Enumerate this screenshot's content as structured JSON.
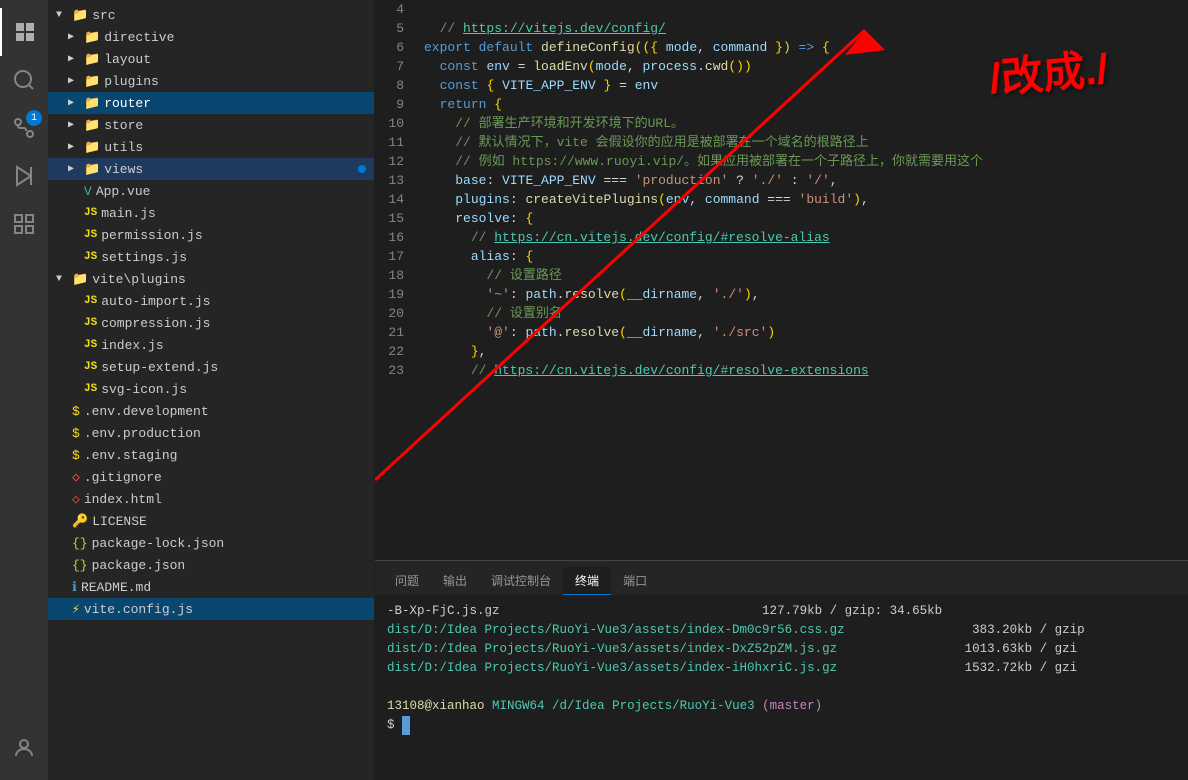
{
  "sidebar": {
    "icons": [
      {
        "name": "explorer-icon",
        "symbol": "⎘",
        "active": true,
        "badge": null
      },
      {
        "name": "search-icon",
        "symbol": "🔍",
        "active": false,
        "badge": null
      },
      {
        "name": "git-icon",
        "symbol": "⎇",
        "active": false,
        "badge": "1"
      },
      {
        "name": "debug-icon",
        "symbol": "▶",
        "active": false,
        "badge": null
      },
      {
        "name": "extensions-icon",
        "symbol": "⊞",
        "active": false,
        "badge": null
      },
      {
        "name": "accounts-icon",
        "symbol": "◉",
        "active": false,
        "badge": null
      }
    ],
    "tree": [
      {
        "label": "src",
        "indent": 0,
        "type": "folder",
        "expanded": true,
        "arrow": "▼"
      },
      {
        "label": "directive",
        "indent": 1,
        "type": "folder",
        "expanded": false,
        "arrow": "▶"
      },
      {
        "label": "layout",
        "indent": 1,
        "type": "folder",
        "expanded": false,
        "arrow": "▶"
      },
      {
        "label": "plugins",
        "indent": 1,
        "type": "folder",
        "expanded": false,
        "arrow": "▶"
      },
      {
        "label": "router",
        "indent": 1,
        "type": "folder",
        "expanded": false,
        "arrow": "▶",
        "active": true
      },
      {
        "label": "store",
        "indent": 1,
        "type": "folder",
        "expanded": false,
        "arrow": "▶"
      },
      {
        "label": "utils",
        "indent": 1,
        "type": "folder",
        "expanded": false,
        "arrow": "▶"
      },
      {
        "label": "views",
        "indent": 1,
        "type": "folder",
        "expanded": false,
        "arrow": "▶",
        "dot": true
      },
      {
        "label": "App.vue",
        "indent": 1,
        "type": "vue"
      },
      {
        "label": "main.js",
        "indent": 1,
        "type": "js"
      },
      {
        "label": "permission.js",
        "indent": 1,
        "type": "js"
      },
      {
        "label": "settings.js",
        "indent": 1,
        "type": "js"
      },
      {
        "label": "vite\\plugins",
        "indent": 0,
        "type": "folder",
        "expanded": true,
        "arrow": "▼"
      },
      {
        "label": "auto-import.js",
        "indent": 1,
        "type": "js"
      },
      {
        "label": "compression.js",
        "indent": 1,
        "type": "js"
      },
      {
        "label": "index.js",
        "indent": 1,
        "type": "js"
      },
      {
        "label": "setup-extend.js",
        "indent": 1,
        "type": "js"
      },
      {
        "label": "svg-icon.js",
        "indent": 1,
        "type": "js"
      },
      {
        "label": ".env.development",
        "indent": 0,
        "type": "env"
      },
      {
        "label": ".env.production",
        "indent": 0,
        "type": "env"
      },
      {
        "label": ".env.staging",
        "indent": 0,
        "type": "env"
      },
      {
        "label": ".gitignore",
        "indent": 0,
        "type": "git"
      },
      {
        "label": "index.html",
        "indent": 0,
        "type": "html"
      },
      {
        "label": "LICENSE",
        "indent": 0,
        "type": "license"
      },
      {
        "label": "package-lock.json",
        "indent": 0,
        "type": "json"
      },
      {
        "label": "package.json",
        "indent": 0,
        "type": "json"
      },
      {
        "label": "README.md",
        "indent": 0,
        "type": "md"
      },
      {
        "label": "vite.config.js",
        "indent": 0,
        "type": "js",
        "selected": true
      }
    ]
  },
  "editor": {
    "lines": [
      {
        "num": 4,
        "code": ""
      },
      {
        "num": 5,
        "code": "  // https://vitejs.dev/config/"
      },
      {
        "num": 6,
        "code": "export default defineConfig(({ mode, command }) => {"
      },
      {
        "num": 7,
        "code": "  const env = loadEnv(mode, process.cwd())"
      },
      {
        "num": 8,
        "code": "  const { VITE_APP_ENV } = env"
      },
      {
        "num": 9,
        "code": "  return {"
      },
      {
        "num": 10,
        "code": "    // 部署生产环境和开发环境下的URL。"
      },
      {
        "num": 11,
        "code": "    // 默认情况下，vite 会假设你的应用是被部署在一个域名的根路径上"
      },
      {
        "num": 12,
        "code": "    // 例如 https://www.ruoyi.vip/。如果应用被部署在一个子路径上，你就需要用这个"
      },
      {
        "num": 13,
        "code": "    base: VITE_APP_ENV === 'production' ? './' : '/',"
      },
      {
        "num": 14,
        "code": "    plugins: createVitePlugins(env, command === 'build'),"
      },
      {
        "num": 15,
        "code": "    resolve: {"
      },
      {
        "num": 16,
        "code": "      // https://cn.vitejs.dev/config/#resolve-alias"
      },
      {
        "num": 17,
        "code": "      alias: {"
      },
      {
        "num": 18,
        "code": "        // 设置路径"
      },
      {
        "num": 19,
        "code": "        '~': path.resolve(__dirname, './'),"
      },
      {
        "num": 20,
        "code": "        // 设置别名"
      },
      {
        "num": 21,
        "code": "        '@': path.resolve(__dirname, './src')"
      },
      {
        "num": 22,
        "code": "      },"
      },
      {
        "num": 23,
        "code": "      // https://cn.vitejs.dev/config/#resolve-extensions"
      }
    ]
  },
  "terminal": {
    "tabs": [
      "问题",
      "输出",
      "调试控制台",
      "终端",
      "端口"
    ],
    "active_tab": "终端",
    "lines": [
      "-B-Xp-FjC.js.gz                                   127.79kb / gzip: 34.65kb",
      "dist/D:/Idea Projects/RuoYi-Vue3/assets/index-Dm0c9r56.css.gz                 383.20kb / gzip",
      "dist/D:/Idea Projects/RuoYi-Vue3/assets/index-DxZ52pZM.js.gz                 1013.63kb / gzi",
      "dist/D:/Idea Projects/RuoYi-Vue3/assets/index-iH0hxriC.js.gz                 1532.72kb / gzi",
      "",
      "13108@xianhao MINGW64 /d/Idea Projects/RuoYi-Vue3 (master)",
      "$ "
    ],
    "prompt_user": "13108@xianhao",
    "prompt_path": "MINGW64 /d/Idea Projects/RuoYi-Vue3",
    "prompt_branch": "(master)"
  },
  "annotation": {
    "text": "/改成./"
  }
}
